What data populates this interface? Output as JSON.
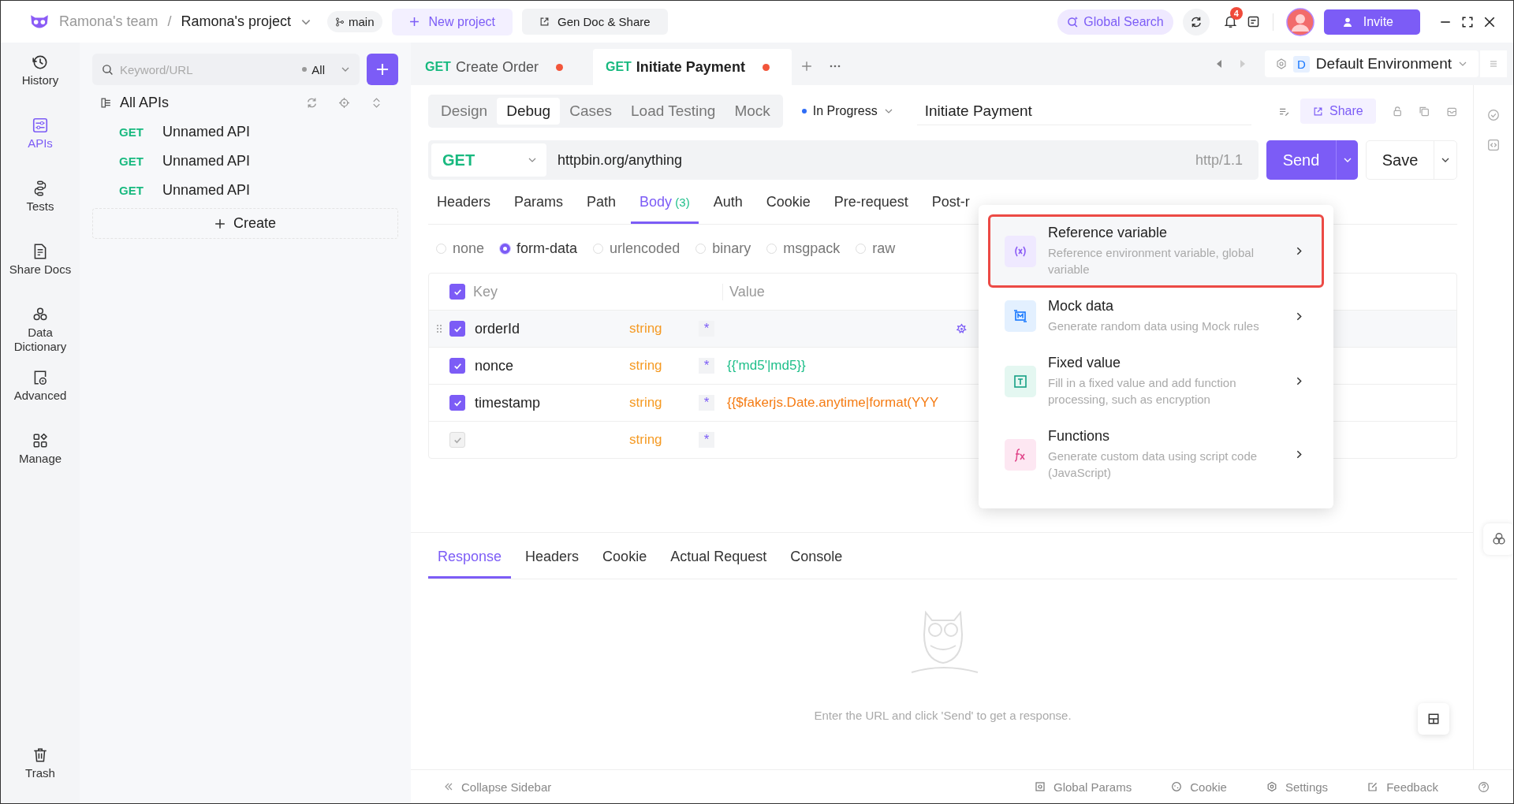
{
  "header": {
    "team": "Ramona's team",
    "separator": "/",
    "project": "Ramona's project",
    "branch": "main",
    "new_project": "New project",
    "gen_doc": "Gen Doc & Share",
    "global_search": "Global Search",
    "notification_count": "4",
    "invite": "Invite"
  },
  "nav": [
    {
      "label": "History",
      "selected": false
    },
    {
      "label": "APIs",
      "selected": true
    },
    {
      "label": "Tests",
      "selected": false
    },
    {
      "label": "Share Docs",
      "selected": false
    },
    {
      "label": "Data Dictionary",
      "selected": false
    },
    {
      "label": "Advanced",
      "selected": false
    },
    {
      "label": "Manage",
      "selected": false
    },
    {
      "label": "Trash",
      "selected": false
    }
  ],
  "api_sidebar": {
    "search_placeholder": "Keyword/URL",
    "filter": "All",
    "tree_title": "All APIs",
    "items": [
      {
        "method": "GET",
        "name": "Unnamed API"
      },
      {
        "method": "GET",
        "name": "Unnamed API"
      },
      {
        "method": "GET",
        "name": "Unnamed API"
      }
    ],
    "create": "Create"
  },
  "tabs": [
    {
      "method": "GET",
      "label": "Create Order",
      "selected": false,
      "unsaved": true
    },
    {
      "method": "GET",
      "label": "Initiate Payment",
      "selected": true,
      "unsaved": true
    }
  ],
  "environment": {
    "badge": "D",
    "name": "Default Environment"
  },
  "mode_tabs": [
    {
      "label": "Design",
      "selected": false
    },
    {
      "label": "Debug",
      "selected": true
    },
    {
      "label": "Cases",
      "selected": false
    },
    {
      "label": "Load Testing",
      "selected": false
    },
    {
      "label": "Mock",
      "selected": false
    }
  ],
  "status": {
    "label": "In Progress",
    "color": "#2f6df6"
  },
  "api_name": "Initiate Payment",
  "share": "Share",
  "request": {
    "method": "GET",
    "url": "httpbin.org/anything",
    "protocol": "http/1.1",
    "send": "Send",
    "save": "Save"
  },
  "param_tabs": [
    {
      "label": "Headers",
      "selected": false
    },
    {
      "label": "Params",
      "selected": false
    },
    {
      "label": "Path",
      "selected": false
    },
    {
      "label": "Body",
      "count": "(3)",
      "selected": true
    },
    {
      "label": "Auth",
      "selected": false
    },
    {
      "label": "Cookie",
      "selected": false
    },
    {
      "label": "Pre-request",
      "selected": false
    },
    {
      "label": "Post-r",
      "selected": false
    }
  ],
  "body_types": [
    {
      "label": "none",
      "selected": false
    },
    {
      "label": "form-data",
      "selected": true
    },
    {
      "label": "urlencoded",
      "selected": false
    },
    {
      "label": "binary",
      "selected": false
    },
    {
      "label": "msgpack",
      "selected": false
    },
    {
      "label": "raw",
      "selected": false
    }
  ],
  "body_table": {
    "columns": [
      "Key",
      "Value"
    ],
    "all_checked": true,
    "rows": [
      {
        "checked": true,
        "disabled": false,
        "hovered": true,
        "key": "orderId",
        "type": "string",
        "required": "*"
      },
      {
        "checked": true,
        "disabled": false,
        "hovered": false,
        "key": "nonce",
        "type": "string",
        "required": "*",
        "value": "{{'md5'|md5}}",
        "color": "#1fbf8a"
      },
      {
        "checked": true,
        "disabled": false,
        "hovered": false,
        "key": "timestamp",
        "type": "string",
        "required": "*",
        "value": "{{$fakerjs.Date.anytime|format(YYY",
        "color": "#f57c14"
      },
      {
        "checked": true,
        "disabled": true,
        "hovered": false,
        "type": "string",
        "required": "*"
      }
    ]
  },
  "value_menu": {
    "items": [
      {
        "kind": "variable",
        "title": "Reference variable",
        "description": "Reference environment variable, global variable",
        "highlighted": true
      },
      {
        "kind": "mock",
        "title": "Mock data",
        "description": "Generate random data using Mock rules",
        "highlighted": false
      },
      {
        "kind": "fixed",
        "title": "Fixed value",
        "description": "Fill in a fixed value and add function processing, such as encryption",
        "highlighted": false
      },
      {
        "kind": "function",
        "title": "Functions",
        "description": "Generate custom data using script code (JavaScript)",
        "highlighted": false
      }
    ]
  },
  "response": {
    "tabs": [
      {
        "label": "Response",
        "selected": true
      },
      {
        "label": "Headers",
        "selected": false
      },
      {
        "label": "Cookie",
        "selected": false
      },
      {
        "label": "Actual Request",
        "selected": false
      },
      {
        "label": "Console",
        "selected": false
      }
    ],
    "empty_message": "Enter the URL and click 'Send' to get a response."
  },
  "status_bar": {
    "collapse": "Collapse Sidebar",
    "items": [
      "Global Params",
      "Cookie",
      "Settings",
      "Feedback"
    ]
  }
}
